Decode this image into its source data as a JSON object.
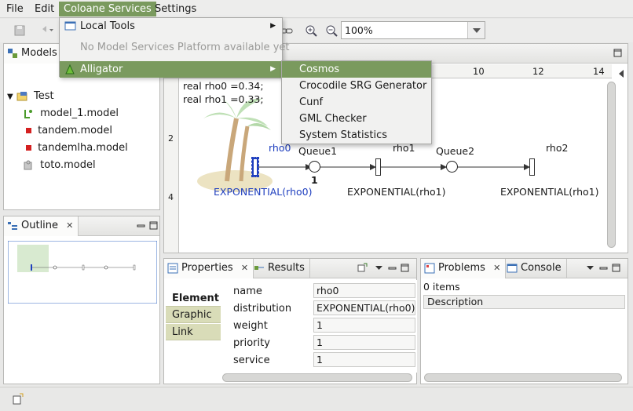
{
  "menubar": {
    "items": [
      "File",
      "Edit",
      "Coloane Services",
      "Settings"
    ]
  },
  "toolbar": {
    "zoom_value": "100%"
  },
  "coloane_menu": {
    "local_tools": "Local Tools",
    "no_platform": "No Model Services Platform available yet",
    "alligator": "Alligator"
  },
  "alligator_menu": {
    "items": [
      "Cosmos",
      "Crocodile SRG Generator",
      "Cunf",
      "GML Checker",
      "System Statistics"
    ]
  },
  "models_view": {
    "tab_label": "Models",
    "tree": {
      "root": "Test",
      "files": [
        "model_1.model",
        "tandem.model",
        "tandemlha.model",
        "toto.model"
      ]
    }
  },
  "outline_view": {
    "tab_label": "Outline"
  },
  "editor": {
    "ruler_ticks": [
      "10",
      "12",
      "14"
    ],
    "vruler_ticks": [
      "2",
      "4"
    ],
    "header_lines": [
      "real rho0 =0.34;",
      "real rho1 =0.33;"
    ],
    "nodes": {
      "t0_label": "rho0",
      "t0_dist": "EXPONENTIAL(rho0)",
      "p1_label": "Queue1",
      "p1_tokens": "1",
      "t1_label": "rho1",
      "t1_dist": "EXPONENTIAL(rho1)",
      "p2_label": "Queue2",
      "t2_label": "rho2",
      "t2_dist": "EXPONENTIAL(rho1)"
    }
  },
  "properties_view": {
    "tab_label": "Properties",
    "results_tab": "Results",
    "categories": [
      "Element",
      "Graphic",
      "Link"
    ],
    "fields": [
      {
        "label": "name",
        "value": "rho0"
      },
      {
        "label": "distribution",
        "value": "EXPONENTIAL(rho0)"
      },
      {
        "label": "weight",
        "value": "1"
      },
      {
        "label": "priority",
        "value": "1"
      },
      {
        "label": "service",
        "value": "1"
      }
    ]
  },
  "problems_view": {
    "tab_label": "Problems",
    "console_tab": "Console",
    "count": "0 items",
    "column": "Description"
  },
  "colors": {
    "menu_highlight": "#7a9a5e",
    "selected_blue": "#1f3fbf"
  }
}
